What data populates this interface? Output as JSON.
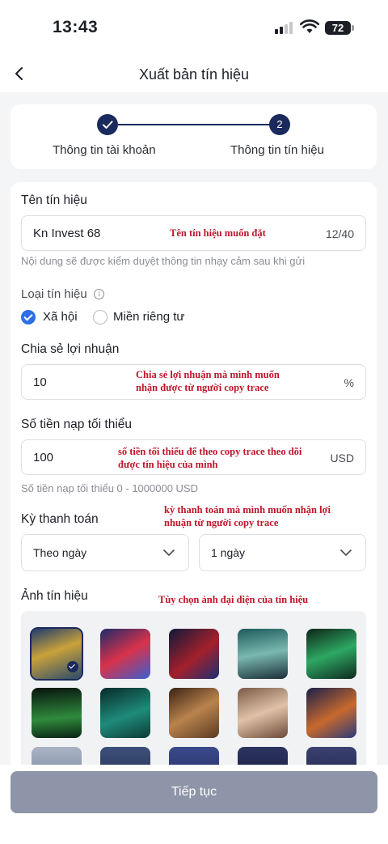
{
  "status": {
    "time": "13:43",
    "battery": "72"
  },
  "nav": {
    "title": "Xuất bản tín hiệu"
  },
  "stepper": {
    "step1_label": "Thông tin tài khoản",
    "step2_number": "2",
    "step2_label": "Thông tin tín hiệu"
  },
  "form": {
    "signal_name": {
      "label": "Tên tín hiệu",
      "value": "Kn Invest 68",
      "counter": "12/40",
      "note": "Tên tín hiệu muốn đặt",
      "hint": "Nội dung sẽ được kiểm duyệt thông tin nhạy cảm sau khi gửi"
    },
    "signal_type": {
      "label": "Loại tín hiệu",
      "options": [
        "Xã hội",
        "Miền riêng tư"
      ],
      "selected": "Xã hội"
    },
    "profit_share": {
      "label": "Chia sẻ lợi nhuận",
      "value": "10",
      "suffix": "%",
      "note_line1": "Chia sẻ lợi nhuận mà mình muốn",
      "note_line2": "nhận được từ người copy trace"
    },
    "min_deposit": {
      "label": "Số tiền nạp tối thiểu",
      "value": "100",
      "suffix": "USD",
      "note_line1": "số tiền tối thiểu để theo copy trace theo dõi",
      "note_line2": "được tín hiệu của mình",
      "hint": "Số tiền nạp tối thiểu 0 - 1000000 USD"
    },
    "payment_period": {
      "label": "Kỳ thanh toán",
      "note_line1": "kỳ thanh toán mà mình muốn nhận lợi",
      "note_line2": "nhuận từ người copy trace",
      "period_value": "Theo ngày",
      "interval_value": "1 ngày"
    },
    "signal_image": {
      "label": "Ảnh tín hiệu",
      "note": "Tùy chọn ảnh đại diện của tín hiệu",
      "selected_index": 0
    }
  },
  "footer": {
    "continue_label": "Tiếp tục"
  },
  "colors": {
    "primary": "#1a2a5c",
    "radio_on": "#2c6fe8",
    "button_disabled": "#8e95a8",
    "note_red": "#c0152a"
  }
}
